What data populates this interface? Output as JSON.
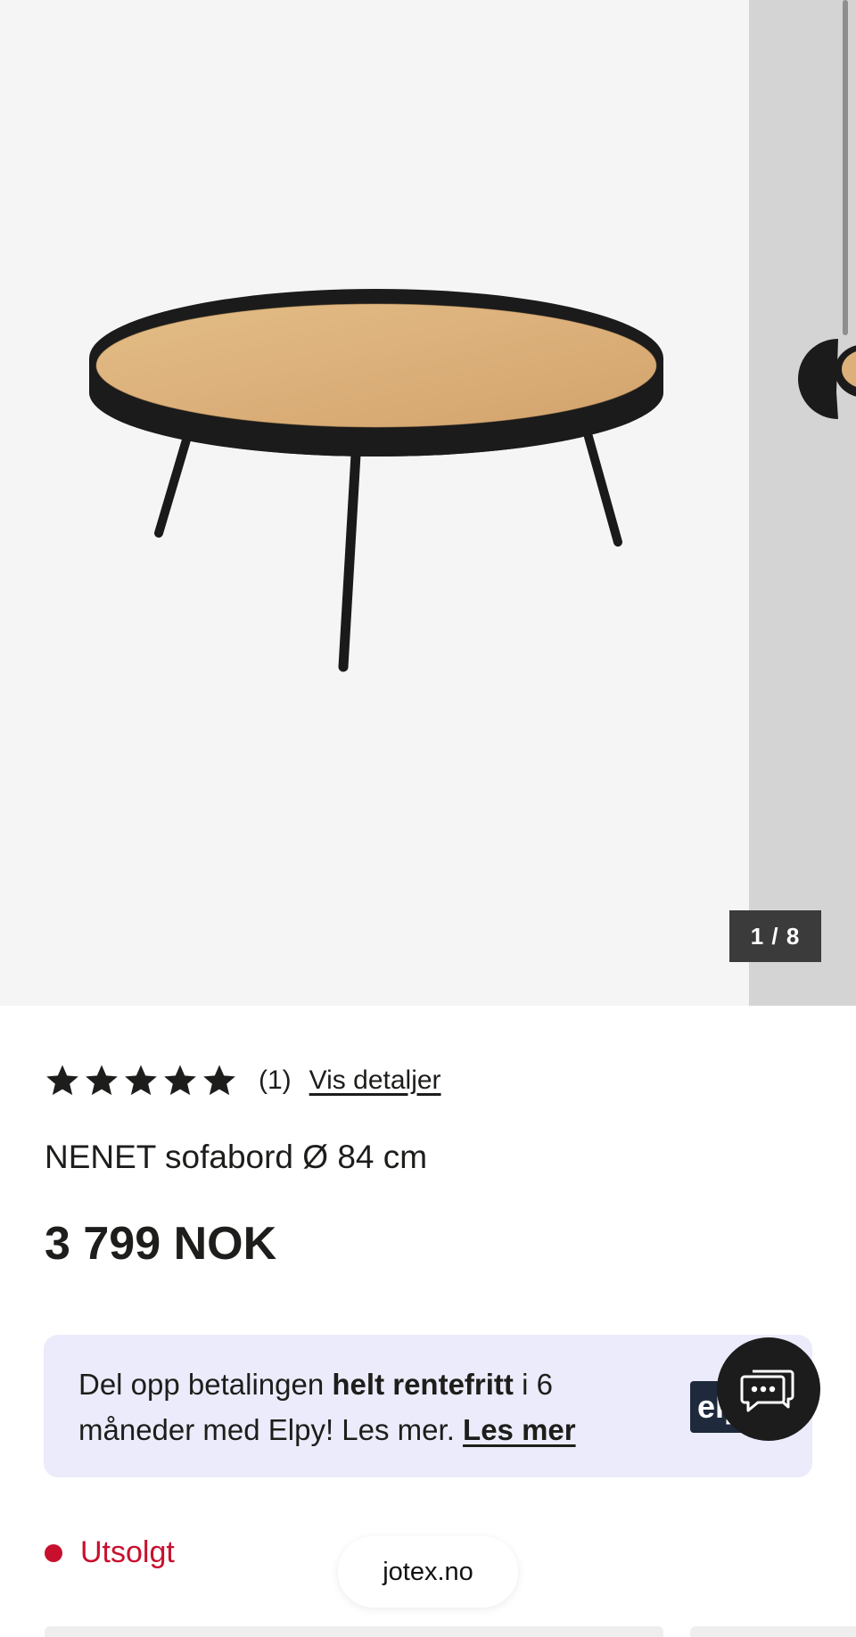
{
  "gallery": {
    "counter": "1 / 8",
    "image_alt": "NENET sofabord"
  },
  "rating": {
    "stars": 5,
    "count": "(1)",
    "details_link": "Vis detaljer"
  },
  "product": {
    "title": "NENET sofabord Ø 84 cm",
    "price": "3 799 NOK"
  },
  "finance": {
    "text_before": "Del opp betalingen ",
    "text_bold": "helt rentefritt",
    "text_after": " i 6 måneder med Elpy! Les mer. ",
    "link": "Les mer",
    "logo_text": "elpy"
  },
  "stock": {
    "status": "Utsolgt",
    "color": "#c8102e"
  },
  "browser": {
    "domain": "jotex.no"
  },
  "chat": {
    "icon": "chat-bubble-icon"
  }
}
